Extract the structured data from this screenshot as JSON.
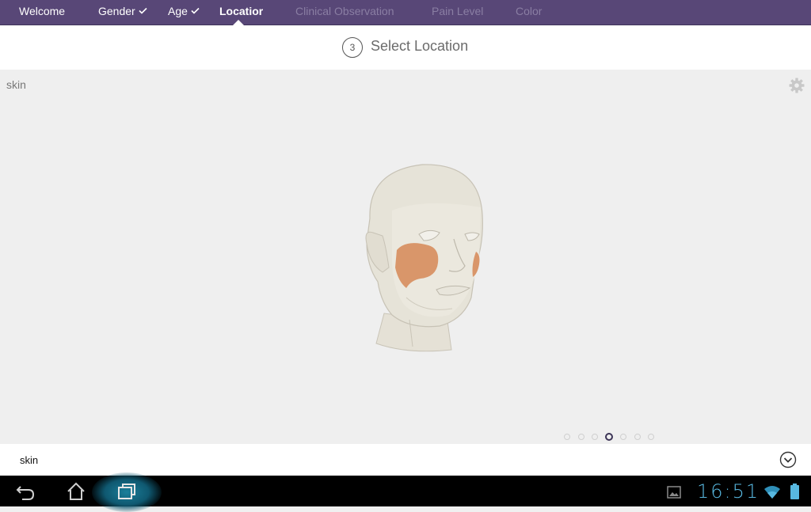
{
  "nav": {
    "steps": [
      {
        "label": "Welcome",
        "state": "done"
      },
      {
        "label": "Gender",
        "state": "done",
        "checked": true
      },
      {
        "label": "Age",
        "state": "done",
        "checked": true
      },
      {
        "label": "Locatior",
        "state": "active"
      },
      {
        "label": "Clinical Observation",
        "state": "disabled"
      },
      {
        "label": "Pain Level",
        "state": "disabled"
      },
      {
        "label": "Color",
        "state": "disabled"
      }
    ]
  },
  "header": {
    "step_number": "3",
    "title": "Select Location"
  },
  "main": {
    "layer_label": "skin",
    "pager": {
      "count": 7,
      "active_index": 3
    }
  },
  "bottom": {
    "label": "skin"
  },
  "system": {
    "clock": "16:51"
  },
  "colors": {
    "nav_bg": "#584777",
    "highlight": "#d9966a",
    "clock": "#58b8e0"
  }
}
